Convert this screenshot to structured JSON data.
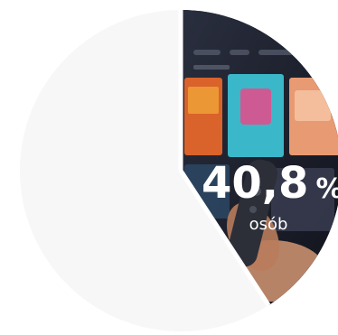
{
  "chart_data": {
    "type": "pie",
    "slices": [
      {
        "value": 40.8,
        "color": "#1b1e29"
      },
      {
        "value": 59.2,
        "color": "#f7f7f7"
      }
    ],
    "highlight": {
      "number": "40,8",
      "unit": "%",
      "sublabel": "osób"
    }
  }
}
